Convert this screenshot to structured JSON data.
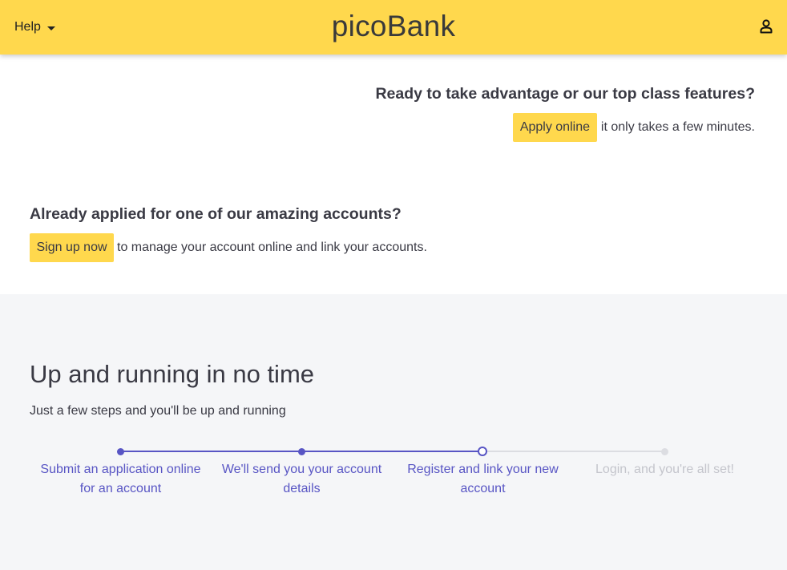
{
  "header": {
    "help_label": "Help",
    "logo": "picoBank",
    "user_icon": "user-icon",
    "background_color": "#ffd84d"
  },
  "apply": {
    "heading": "Ready to take advantage or our top class features?",
    "button_label": "Apply online",
    "trailing_text": "it only takes a few minutes."
  },
  "signup": {
    "heading": "Already applied for one of our amazing accounts?",
    "button_label": "Sign up now",
    "trailing_text": "to manage your account online and link your accounts."
  },
  "onboarding": {
    "title": "Up and running in no time",
    "subtitle": "Just a few steps and you'll be up and running",
    "accent_color": "#5855c4",
    "inactive_color": "#dcdde2",
    "current_step": 3,
    "steps": [
      {
        "line1": "Submit an application online",
        "line2": "for an account",
        "status": "done"
      },
      {
        "line1": "We'll send you your account",
        "line2": "details",
        "status": "done"
      },
      {
        "line1": "Register and link your new",
        "line2": "account",
        "status": "current"
      },
      {
        "line1": "Login, and you're all set!",
        "line2": "",
        "status": "todo"
      }
    ]
  }
}
